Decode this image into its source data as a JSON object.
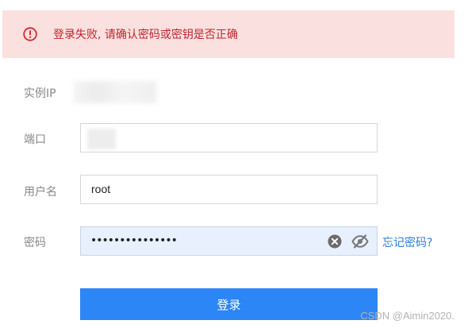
{
  "alert": {
    "message": "登录失败, 请确认密码或密钥是否正确",
    "icon": "error-circle-icon",
    "color": "#c0262d",
    "background": "#fbe0e0"
  },
  "form": {
    "instance_ip_label": "实例IP",
    "port_label": "端口",
    "username_label": "用户名",
    "username_value": "root",
    "password_label": "密码",
    "password_masked": "•••••••••••••••",
    "forgot_password_link": "忘记密码?",
    "clear_icon": "clear-icon",
    "toggle_visibility_icon": "eye-slash-icon"
  },
  "login_button": {
    "label": "登录",
    "color": "#2d86f5"
  },
  "watermark": {
    "text": "CSDN @Aimin2020."
  }
}
